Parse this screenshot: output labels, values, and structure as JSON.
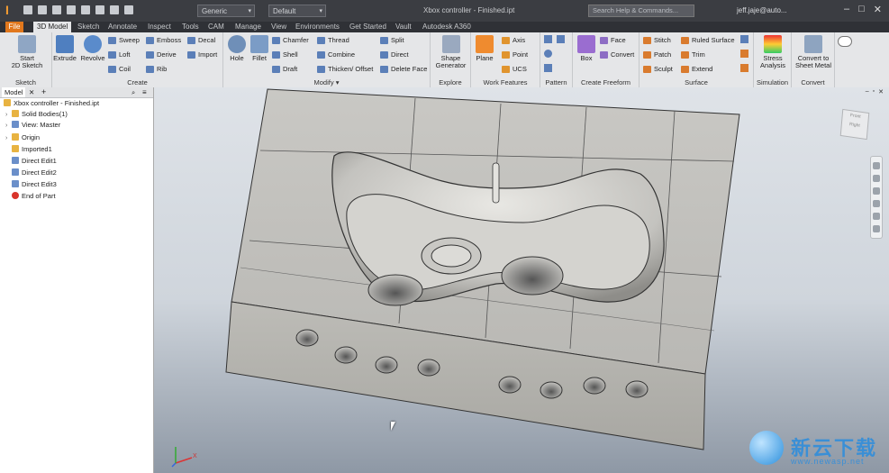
{
  "app": {
    "title": "Xbox controller - Finished.ipt",
    "help_search_placeholder": "Search Help & Commands...",
    "user": "jeff.jaje@auto...",
    "material": "Generic",
    "appearance": "Default",
    "accent_color": "#e1771c"
  },
  "tabs": [
    "File",
    "3D Model",
    "Sketch",
    "Annotate",
    "Inspect",
    "Tools",
    "CAM",
    "Manage",
    "View",
    "Environments",
    "Get Started",
    "Vault",
    "Autodesk A360"
  ],
  "active_tab": "3D Model",
  "ribbon": {
    "sketch": {
      "label": "Sketch",
      "start": "Start\n2D Sketch"
    },
    "create": {
      "label": "Create",
      "extrude": "Extrude",
      "revolve": "Revolve",
      "sweep": "Sweep",
      "loft": "Loft",
      "coil": "Coil",
      "emboss": "Emboss",
      "derive": "Derive",
      "rib": "Rib",
      "decal": "Decal",
      "import": "Import"
    },
    "modify": {
      "label": "Modify ▾",
      "hole": "Hole",
      "fillet": "Fillet",
      "chamfer": "Chamfer",
      "shell": "Shell",
      "draft": "Draft",
      "thread": "Thread",
      "combine": "Combine",
      "thicken": "Thicken/ Offset",
      "split": "Split",
      "direct": "Direct",
      "delete_face": "Delete Face"
    },
    "explore": {
      "label": "Explore",
      "shape_generator": "Shape\nGenerator"
    },
    "work_features": {
      "label": "Work Features",
      "plane": "Plane",
      "axis": "Axis",
      "point": "Point",
      "ucs": "UCS"
    },
    "pattern": {
      "label": "Pattern"
    },
    "freeform": {
      "label": "Create Freeform",
      "box": "Box",
      "face": "Face",
      "convert": "Convert"
    },
    "surface": {
      "label": "Surface",
      "stitch": "Stitch",
      "patch": "Patch",
      "sculpt": "Sculpt",
      "ruled_surface": "Ruled Surface",
      "trim": "Trim",
      "extend": "Extend"
    },
    "simulation": {
      "label": "Simulation",
      "stress": "Stress\nAnalysis"
    },
    "convert": {
      "label": "Convert",
      "sheet_metal": "Convert to\nSheet Metal"
    }
  },
  "browser": {
    "tab": "Model",
    "items": [
      {
        "label": "Xbox controller - Finished.ipt",
        "color": "#e8b341"
      },
      {
        "label": "Solid Bodies(1)",
        "color": "#e8b341"
      },
      {
        "label": "View: Master",
        "color": "#6b8fc9"
      },
      {
        "label": "Origin",
        "color": "#e8b341"
      },
      {
        "label": "Imported1",
        "color": "#e8b341"
      },
      {
        "label": "Direct Edit1",
        "color": "#6b8fc9"
      },
      {
        "label": "Direct Edit2",
        "color": "#6b8fc9"
      },
      {
        "label": "Direct Edit3",
        "color": "#6b8fc9"
      },
      {
        "label": "End of Part",
        "color": "#d9342b"
      }
    ]
  },
  "viewcube": {
    "front": "Front",
    "right": "Right"
  },
  "triad": {
    "axis_label": "X"
  },
  "watermark": {
    "text": "新云下载",
    "url": "www.newasp.net"
  }
}
